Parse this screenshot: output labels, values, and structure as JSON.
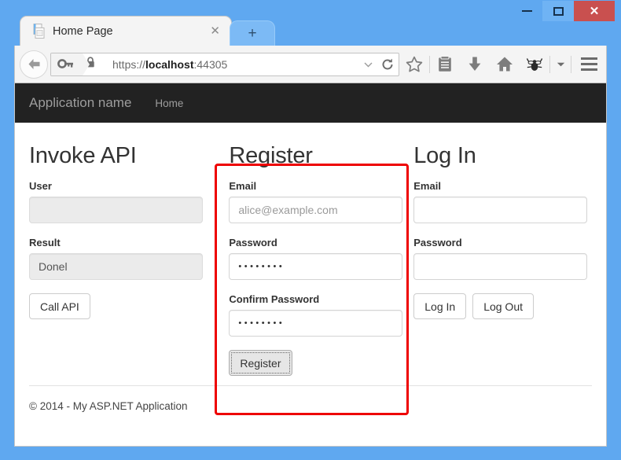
{
  "window": {
    "controls": {
      "minimize": "minimize",
      "maximize": "maximize",
      "close": "✕"
    }
  },
  "browser": {
    "tab": {
      "title": "Home Page",
      "close_label": "✕",
      "favicon": "page-icon"
    },
    "new_tab_label": "+",
    "toolbar": {
      "back_icon": "back-arrow-icon",
      "identity_icon": "key-icon",
      "lock_icon": "padlock-icon",
      "url_scheme": "https://",
      "url_host": "localhost",
      "url_port": ":44305",
      "url_full": "https://localhost:44305",
      "dropdown_icon": "chevron-down-icon",
      "reload_icon": "reload-icon",
      "buttons": [
        {
          "name": "bookmark-star-icon",
          "label": "Bookmark"
        },
        {
          "name": "reader-list-icon",
          "label": "Reading list"
        },
        {
          "name": "download-arrow-icon",
          "label": "Downloads"
        },
        {
          "name": "home-icon",
          "label": "Home"
        },
        {
          "name": "firebug-icon",
          "label": "Firebug"
        },
        {
          "name": "overflow-chevron-icon",
          "label": "More"
        }
      ],
      "menu_icon": "hamburger-menu-icon"
    }
  },
  "site": {
    "navbar": {
      "brand": "Application name",
      "links": [
        {
          "label": "Home"
        }
      ]
    },
    "columns": [
      {
        "id": "invoke-api",
        "heading": "Invoke API",
        "fields": [
          {
            "label": "User",
            "value": "",
            "placeholder": "",
            "disabled": true,
            "type": "text"
          },
          {
            "label": "Result",
            "value": "Donel",
            "placeholder": "",
            "disabled": true,
            "type": "text"
          }
        ],
        "buttons": [
          {
            "label": "Call API",
            "focused": false
          }
        ]
      },
      {
        "id": "register",
        "heading": "Register",
        "highlighted": true,
        "fields": [
          {
            "label": "Email",
            "value": "",
            "placeholder": "alice@example.com",
            "disabled": false,
            "type": "text"
          },
          {
            "label": "Password",
            "value": "••••••••",
            "placeholder": "",
            "disabled": false,
            "type": "password"
          },
          {
            "label": "Confirm Password",
            "value": "••••••••",
            "placeholder": "",
            "disabled": false,
            "type": "password"
          }
        ],
        "buttons": [
          {
            "label": "Register",
            "focused": true
          }
        ]
      },
      {
        "id": "log-in",
        "heading": "Log In",
        "fields": [
          {
            "label": "Email",
            "value": "",
            "placeholder": "",
            "disabled": false,
            "type": "text"
          },
          {
            "label": "Password",
            "value": "",
            "placeholder": "",
            "disabled": false,
            "type": "password"
          }
        ],
        "buttons": [
          {
            "label": "Log In",
            "focused": false
          },
          {
            "label": "Log Out",
            "focused": false
          }
        ]
      }
    ],
    "footer": "© 2014 - My ASP.NET Application"
  },
  "colors": {
    "window_frame": "#5fa8f0",
    "close_button": "#c9504f",
    "navbar_dark": "#222222",
    "highlight_red": "#ee0000"
  }
}
